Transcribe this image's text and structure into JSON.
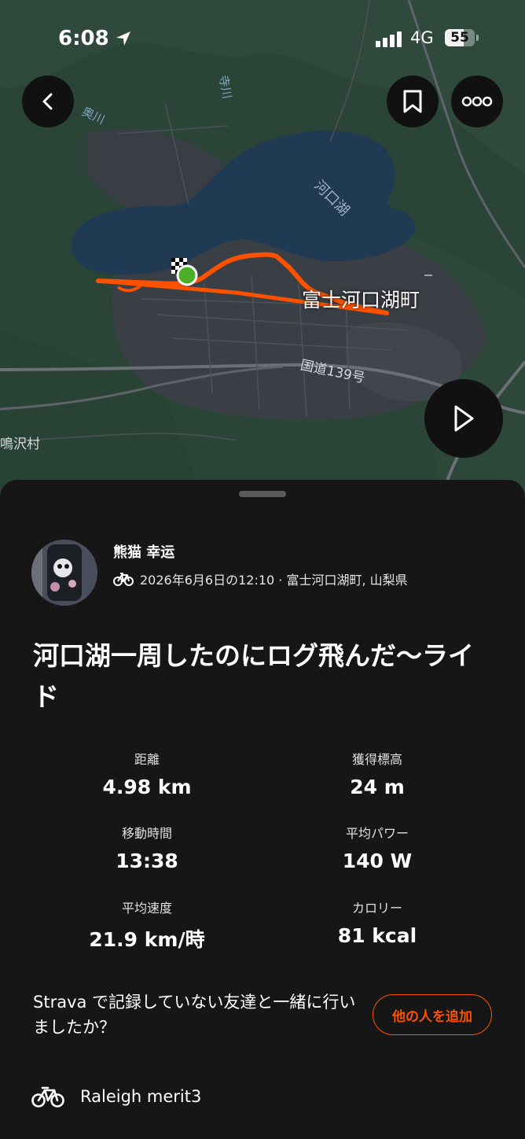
{
  "status_bar": {
    "time": "6:08",
    "network": "4G",
    "battery": "55"
  },
  "map": {
    "labels": {
      "town": "富士河口湖町",
      "lake": "河口湖",
      "road": "国道139号",
      "village": "鳴沢村",
      "river1": "奥川",
      "river2": "寺川"
    }
  },
  "activity": {
    "user_name": "熊猫 幸运",
    "meta": "2026年6月6日の12:10 · 富士河口湖町, 山梨県",
    "title": "河口湖一周したのにログ飛んだ〜ライド",
    "stats": [
      {
        "label": "距離",
        "value": "4.98 km"
      },
      {
        "label": "獲得標高",
        "value": "24 m"
      },
      {
        "label": "移動時間",
        "value": "13:38"
      },
      {
        "label": "平均パワー",
        "value": "140 W"
      },
      {
        "label": "平均速度",
        "value": "21.9 km/時"
      },
      {
        "label": "カロリー",
        "value": "81 kcal"
      }
    ],
    "friends_question": "Strava で記録していない友達と一緒に行いましたか？",
    "add_people_label": "他の人を追加",
    "gear_name": "Raleigh merit3"
  },
  "colors": {
    "accent": "#fc5200",
    "route": "#fc5200",
    "start_marker": "#4caf28",
    "map_land": "#2b4438",
    "map_water": "#1f3a52",
    "sheet_bg": "#161616"
  },
  "icons": [
    "back-icon",
    "bookmark-icon",
    "more-icon",
    "play-icon",
    "bike-icon",
    "location-arrow-icon",
    "signal-icon"
  ]
}
